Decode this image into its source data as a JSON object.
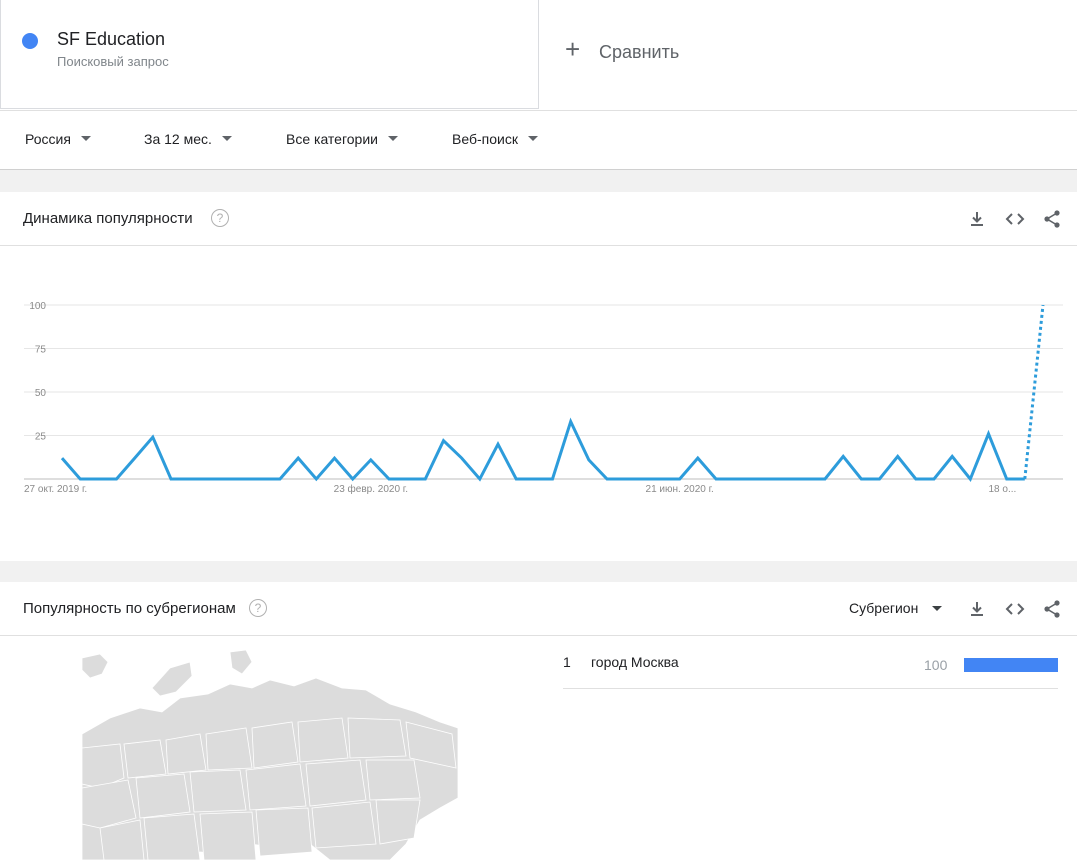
{
  "term": {
    "name": "SF Education",
    "subtitle": "Поисковый запрос",
    "color": "#4285f4"
  },
  "compare": {
    "plus": "+",
    "label": "Сравнить"
  },
  "filters": [
    {
      "label": "Россия"
    },
    {
      "label": "За 12 мес."
    },
    {
      "label": "Все категории"
    },
    {
      "label": "Веб-поиск"
    }
  ],
  "interest": {
    "title": "Динамика популярности",
    "help": "?",
    "icons": [
      "download-icon",
      "embed-icon",
      "share-icon"
    ]
  },
  "chart_data": {
    "type": "line",
    "ylim": [
      0,
      100
    ],
    "yticks": [
      25,
      50,
      75,
      100
    ],
    "ytick_labels": [
      "25",
      "50",
      "75",
      "100"
    ],
    "x_tick_labels": [
      "27 окт. 2019 г.",
      "23 февр. 2020 г.",
      "21 июн. 2020 г.",
      "18 о..."
    ],
    "x_tick_index": [
      0,
      17,
      34,
      51
    ],
    "grid": true,
    "line_color": "#2d9cdb",
    "series": [
      {
        "values": [
          12,
          0,
          0,
          0,
          12,
          24,
          0,
          0,
          0,
          0,
          0,
          0,
          0,
          12,
          0,
          12,
          0,
          11,
          0,
          0,
          0,
          22,
          12,
          0,
          20,
          0,
          0,
          0,
          33,
          11,
          0,
          0,
          0,
          0,
          0,
          12,
          0,
          0,
          0,
          0,
          0,
          0,
          0,
          13,
          0,
          0,
          13,
          0,
          0,
          13,
          0,
          26,
          0,
          0,
          100
        ],
        "partial_from_index": 53
      }
    ]
  },
  "subregion": {
    "title": "Популярность по субрегионам",
    "help": "?",
    "selector_label": "Субрегион",
    "icons": [
      "download-icon",
      "embed-icon",
      "share-icon"
    ],
    "rows": [
      {
        "rank": "1",
        "name": "город Москва",
        "value": "100",
        "value_fraction": 1.0
      }
    ],
    "bar_color": "#4285f4"
  }
}
